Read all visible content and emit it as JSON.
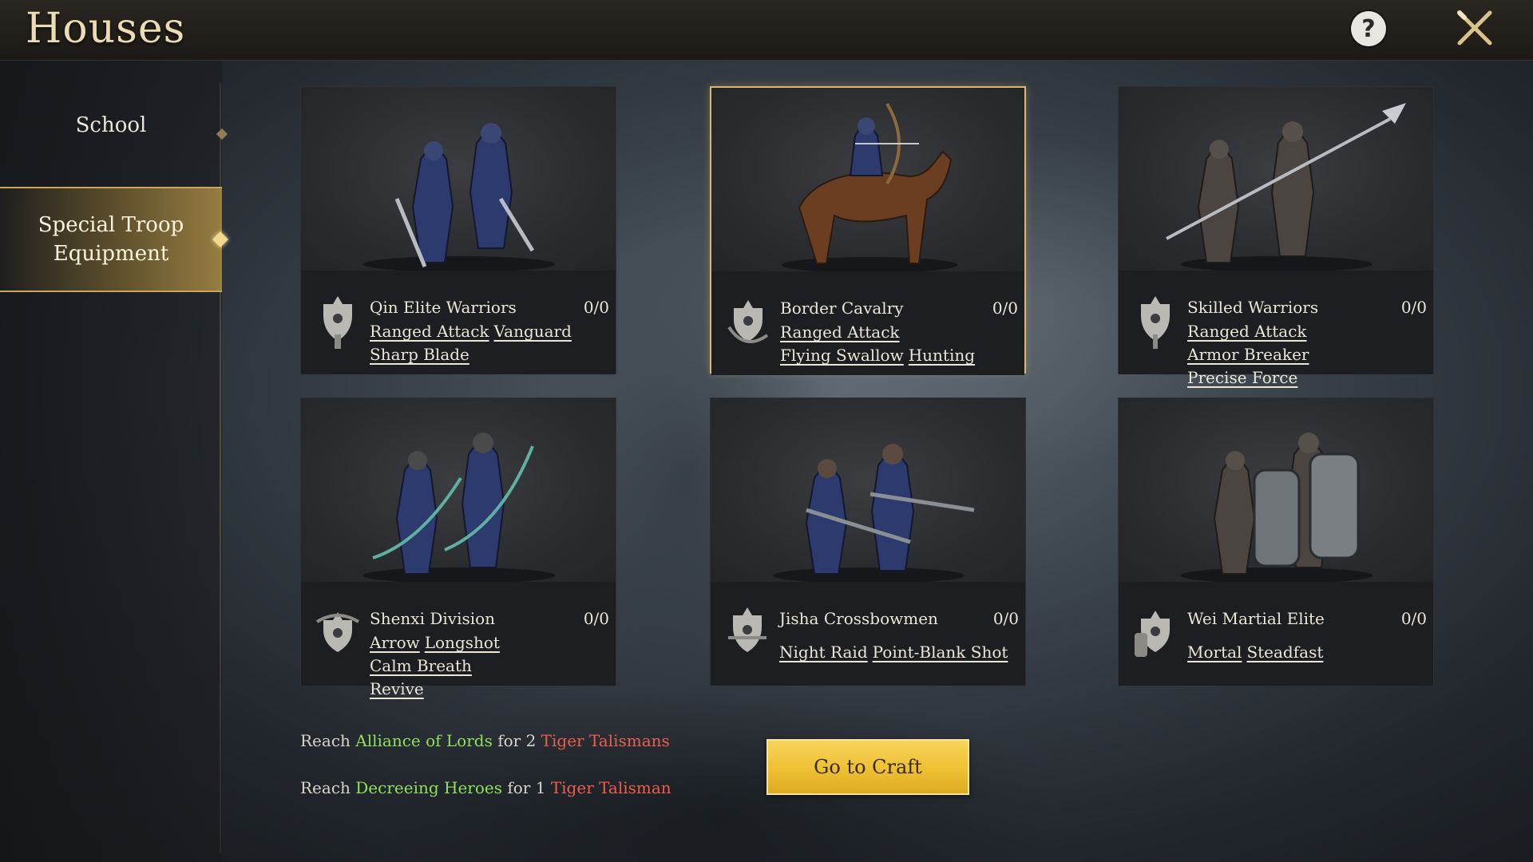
{
  "header": {
    "title": "Houses"
  },
  "sidebar": {
    "items": [
      {
        "label": "School",
        "active": false
      },
      {
        "label": "Special Troop Equipment",
        "active": true
      }
    ]
  },
  "troops": [
    {
      "name": "Qin Elite Warriors",
      "count": "0/0",
      "traits": [
        "Ranged Attack",
        "Vanguard",
        "Sharp Blade"
      ]
    },
    {
      "name": "Border Cavalry",
      "count": "0/0",
      "traits": [
        "Ranged Attack",
        "Flying Swallow",
        "Hunting"
      ]
    },
    {
      "name": "Skilled Warriors",
      "count": "0/0",
      "traits": [
        "Ranged Attack",
        "Armor Breaker",
        "Precise Force"
      ]
    },
    {
      "name": "Shenxi Division",
      "count": "0/0",
      "traits": [
        "Arrow",
        "Longshot",
        "Calm Breath",
        "Revive"
      ]
    },
    {
      "name": "Jisha Crossbowmen",
      "count": "0/0",
      "traits": [
        "Night Raid",
        "Point-Blank Shot"
      ]
    },
    {
      "name": "Wei Martial Elite",
      "count": "0/0",
      "traits": [
        "Mortal",
        "Steadfast"
      ]
    }
  ],
  "rewards": [
    {
      "prefix": "Reach",
      "target": "Alliance of Lords",
      "mid": "for 2",
      "item": "Tiger Talismans"
    },
    {
      "prefix": "Reach",
      "target": "Decreeing Heroes",
      "mid": "for 1",
      "item": "Tiger Talisman"
    }
  ],
  "actions": {
    "craft_label": "Go to Craft"
  },
  "colors": {
    "accent_gold": "#d7b86c",
    "green_text": "#8fe05a",
    "red_text": "#ef5d4d",
    "button_yellow": "#eec033"
  }
}
